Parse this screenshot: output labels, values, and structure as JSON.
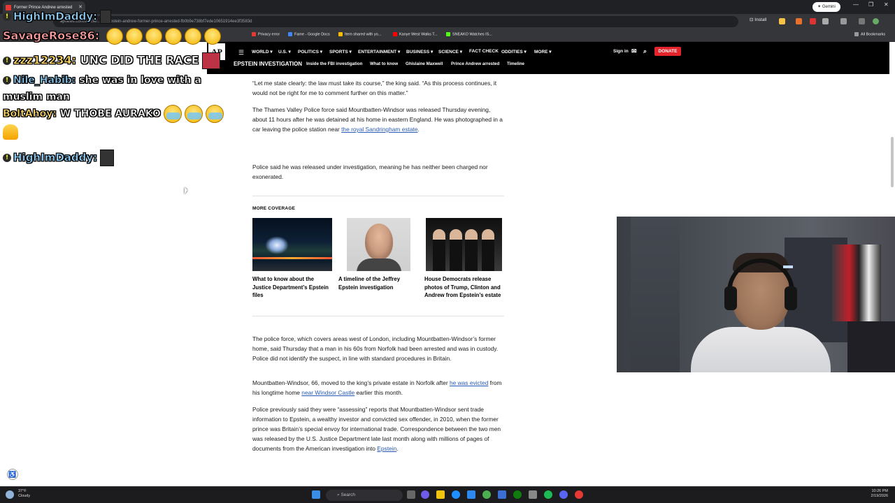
{
  "browser": {
    "tab_title": "Former Prince Andrew arrested",
    "url": "apnews.com/article/...ain-epstein-andrew-former-prince-arrested-fb0b9e738bf7ede10651914ee3f3583d",
    "install_label": "Install",
    "gemini_label": "Gemini",
    "all_bookmarks": "All Bookmarks",
    "bookmarks": [
      "Privacy error",
      "Fame - Google Docs",
      "Item shared with yo...",
      "Kanye West Walks T...",
      "SNEAKO Watches IS..."
    ]
  },
  "chat": {
    "messages": [
      {
        "user": "HighImDaddy:",
        "text": ""
      },
      {
        "user": "SavageRose86:",
        "text": ""
      },
      {
        "user": "zzz12234:",
        "text": "UNC DID THE RACE"
      },
      {
        "user": "Nile_Habib:",
        "text": "she was in love with a muslim man"
      },
      {
        "user": "BoltAhoy:",
        "text": "W THOBE AURAKO"
      },
      {
        "user": "HighImDaddy:",
        "text": ""
      }
    ],
    "nile_line2": "muslim man",
    "nile_line1": "she was in love with a"
  },
  "ap_nav": {
    "logo": "AP",
    "menu": [
      "WORLD",
      "U.S.",
      "POLITICS",
      "SPORTS",
      "ENTERTAINMENT",
      "BUSINESS",
      "SCIENCE",
      "FACT CHECK",
      "ODDITIES",
      "MORE"
    ],
    "sign_in": "Sign in",
    "donate": "DONATE",
    "section": "EPSTEIN INVESTIGATION",
    "subnav": [
      "Inside the FBI investigation",
      "What to know",
      "Ghislaine Maxwell",
      "Prince Andrew arrested",
      "Timeline"
    ]
  },
  "article": {
    "p1": "“Let me state clearly: the law must take its course,” the king said. “As this process continues, it would not be right for me to comment further on this matter.”",
    "p2_text": "The Thames Valley Police force said Mountbatten-Windsor was released Thursday evening, about 11 hours after he was detained at his home in eastern England. He was photographed in a car leaving the police station near ",
    "p2_link": "the royal Sandringham estate",
    "p3": "Police said he was released under investigation, meaning he has neither been charged nor exonerated.",
    "more_coverage": "MORE COVERAGE",
    "cards": [
      {
        "caption": "What to know about the Justice Department’s Epstein files"
      },
      {
        "caption": "A timeline of the Jeffrey Epstein investigation"
      },
      {
        "caption": "House Democrats release photos of Trump, Clinton and Andrew from Epstein’s estate"
      }
    ],
    "p4": "The police force, which covers areas west of London, including Mountbatten-Windsor’s former home, said Thursday that a man in his 60s from Norfolk had been arrested and was in custody. Police did not identify the suspect, in line with standard procedures in Britain.",
    "p5_a": "Mountbatten-Windsor, 66, moved to the king’s private estate in Norfolk after ",
    "p5_link1": "he was evicted",
    "p5_b": " from his longtime home ",
    "p5_link2": "near Windsor Castle",
    "p5_c": " earlier this month.",
    "p6_text": "Police previously said they were “assessing” reports that Mountbatten-Windsor sent trade information to Epstein, a wealthy investor and convicted sex offender, in 2010, when the former prince was Britain’s special envoy for international trade. Correspondence between the two men was released by the U.S. Justice Department late last month along with millions of pages of documents from the American investigation into ",
    "p6_link": "Epstein",
    "p6_end": "."
  },
  "taskbar": {
    "weather_temp": "37°F",
    "weather_desc": "Cloudy",
    "search_placeholder": "Search",
    "time": "10:26 PM",
    "date": "2/19/2026"
  }
}
